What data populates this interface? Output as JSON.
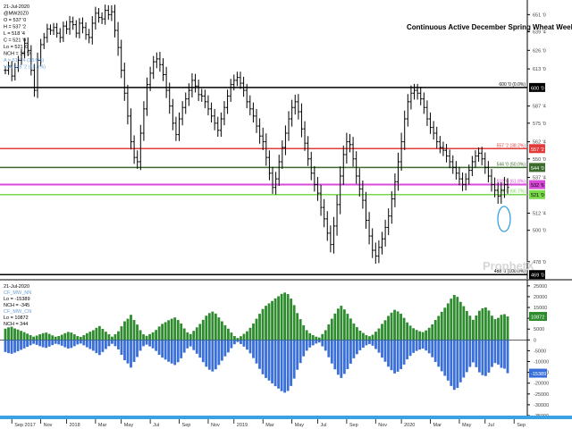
{
  "chart_data": [
    {
      "type": "ohlc",
      "title": "Continuous Active December Spring Wheat Weekly",
      "info_lines": [
        "21-Jul-2020",
        "@MW20Z0",
        "O = 537 '0",
        "H = 537 '2",
        "L = 518 '4",
        "C = 521 '0",
        "Lo = 521 '0",
        "NCH = 16 '0"
      ],
      "indicator_lines": [
        "A = 517 '4 (28.6%)",
        "VvA 518 '2 (18.1%)"
      ],
      "colors": {
        "info": "#000000",
        "indicator": "#6a9fd8",
        "bars": "#000000",
        "line_600": "#000000",
        "line_557": "#e23b3b",
        "line_544": "#3d6b2e",
        "line_532": "#d84bd8",
        "line_525": "#7ad84b",
        "line_469": "#000000",
        "circle": "#3aa2e0"
      },
      "ylim": [
        466,
        660
      ],
      "y_ticks": [
        {
          "v": 651,
          "label": "651 '0"
        },
        {
          "v": 639,
          "label": "639 '4"
        },
        {
          "v": 626,
          "label": "626 '0"
        },
        {
          "v": 613,
          "label": "613 '0"
        },
        {
          "v": 587,
          "label": "587 '4"
        },
        {
          "v": 575,
          "label": "575 '0"
        },
        {
          "v": 562,
          "label": "562 '4"
        },
        {
          "v": 550,
          "label": "550 '0"
        },
        {
          "v": 537,
          "label": "537 '4"
        },
        {
          "v": 512,
          "label": "512 '4"
        },
        {
          "v": 500,
          "label": "500 '0"
        },
        {
          "v": 478,
          "label": "478 '0"
        }
      ],
      "levels": [
        {
          "id": "line_600",
          "value": 600,
          "label": "600 '0 (0.0%)",
          "box": "600 '0"
        },
        {
          "id": "line_557",
          "value": 557.2,
          "label": "557 '2 (38.2%)",
          "box": "557 '2"
        },
        {
          "id": "line_544",
          "value": 544,
          "label": "544 '0 (50.0%)",
          "box": "544 '0"
        },
        {
          "id": "line_532",
          "value": 532,
          "label": "532 '6 (61.8%)",
          "box": "532 '6"
        },
        {
          "id": "line_525",
          "value": 525,
          "label": "525 '0 (66.7%)",
          "box": "521 '0"
        },
        {
          "id": "line_469",
          "value": 469,
          "label": "488 '0 (100.0%)",
          "box": "469 '0"
        }
      ],
      "x_labels": [
        "Sep 2017",
        "Nov",
        "2018",
        "Mar",
        "May",
        "Jul",
        "Sep",
        "Nov",
        "2019",
        "Mar",
        "May",
        "Jul",
        "Sep",
        "Nov",
        "2020",
        "Mar",
        "May",
        "Jul",
        "Sep"
      ],
      "weeks": 157,
      "week_index_of_labels": [
        2,
        11,
        19,
        28,
        36,
        45,
        54,
        63,
        71,
        80,
        89,
        97,
        106,
        115,
        123,
        132,
        141,
        149,
        158
      ],
      "closes": [
        612,
        615,
        608,
        614,
        619,
        624,
        631,
        626,
        612,
        598,
        619,
        630,
        635,
        641,
        640,
        642,
        638,
        635,
        643,
        641,
        646,
        644,
        638,
        645,
        642,
        637,
        635,
        645,
        652,
        649,
        648,
        654,
        651,
        653,
        640,
        628,
        612,
        596,
        580,
        562,
        551,
        548,
        568,
        585,
        602,
        610,
        618,
        620,
        616,
        609,
        598,
        587,
        575,
        567,
        578,
        586,
        592,
        598,
        605,
        601,
        595,
        594,
        590,
        585,
        580,
        575,
        570,
        578,
        586,
        594,
        602,
        605,
        607,
        603,
        598,
        590,
        585,
        580,
        573,
        566,
        562,
        551,
        540,
        530,
        536,
        548,
        558,
        568,
        578,
        586,
        590,
        583,
        571,
        561,
        550,
        540,
        532,
        526,
        516,
        508,
        498,
        490,
        503,
        518,
        538,
        553,
        562,
        560,
        550,
        538,
        529,
        521,
        507,
        496,
        486,
        482,
        488,
        494,
        502,
        510,
        522,
        534,
        548,
        562,
        578,
        590,
        596,
        598,
        596,
        592,
        586,
        578,
        572,
        568,
        562,
        558,
        556,
        552,
        548,
        544,
        540,
        536,
        532,
        536,
        542,
        548,
        552,
        554,
        550,
        544,
        538,
        532,
        528,
        524,
        528,
        532,
        530
      ],
      "spans": [
        6,
        7,
        8,
        7,
        7,
        7,
        8,
        9,
        8,
        10,
        12,
        9,
        7,
        8,
        7,
        7,
        7,
        8,
        7,
        8,
        9,
        8,
        7,
        8,
        9,
        8,
        9,
        11,
        10,
        8,
        8,
        9,
        8,
        10,
        11,
        13,
        12,
        12,
        13,
        12,
        10,
        11,
        13,
        12,
        11,
        10,
        9,
        10,
        11,
        10,
        12,
        12,
        11,
        10,
        10,
        10,
        10,
        11,
        11,
        10,
        10,
        9,
        10,
        10,
        10,
        11,
        10,
        10,
        10,
        10,
        9,
        9,
        9,
        9,
        10,
        10,
        10,
        10,
        11,
        12,
        13,
        13,
        11,
        10,
        11,
        11,
        11,
        12,
        12,
        12,
        11,
        12,
        13,
        12,
        11,
        11,
        11,
        12,
        13,
        13,
        12,
        12,
        14,
        15,
        15,
        14,
        14,
        12,
        12,
        12,
        12,
        13,
        13,
        13,
        12,
        12,
        11,
        11,
        12,
        12,
        12,
        13,
        14,
        14,
        13,
        12,
        12,
        10,
        10,
        10,
        10,
        11,
        10,
        10,
        10,
        9,
        9,
        10,
        10,
        10,
        10,
        10,
        10,
        9,
        9,
        9,
        9,
        9,
        10,
        10,
        10,
        11,
        11,
        12,
        12,
        12,
        10
      ]
    },
    {
      "type": "bar",
      "info_lines": [
        "21-Jul-2020",
        "CF_MW_NN",
        "Lo = -15389",
        "NCH = -345",
        "CF_MW_CN",
        "Lo = 10872",
        "NCH = 344"
      ],
      "colors": {
        "managed": "#2e8b2e",
        "commercial": "#3a6fd8",
        "zero": "#000000",
        "info": "#000000",
        "info2": "#6a9fd8"
      },
      "ylim": [
        -35000,
        27000
      ],
      "y_ticks": [
        {
          "v": 25000,
          "label": "25000"
        },
        {
          "v": 20000,
          "label": "20000"
        },
        {
          "v": 15000,
          "label": "15000"
        },
        {
          "v": 10000,
          "label": "10000"
        },
        {
          "v": 5000,
          "label": "5000"
        },
        {
          "v": 0,
          "label": "0"
        },
        {
          "v": -5000,
          "label": "-5000"
        },
        {
          "v": -10000,
          "label": "-10000"
        },
        {
          "v": -15000,
          "label": "-15000"
        },
        {
          "v": -20000,
          "label": "-20000"
        },
        {
          "v": -25000,
          "label": "-25000"
        },
        {
          "v": -30000,
          "label": "-30000"
        },
        {
          "v": -35000,
          "label": "-35000"
        }
      ],
      "boxes": [
        {
          "value": 10872,
          "label": "10872",
          "color": "#2e8b2e"
        },
        {
          "value": -15389,
          "label": "-15389",
          "color": "#3a6fd8"
        }
      ],
      "series": [
        {
          "values": [
            5200,
            5800,
            6100,
            5300,
            4800,
            4200,
            3600,
            2900,
            2200,
            1500,
            2000,
            2600,
            3100,
            3400,
            2800,
            2100,
            1500,
            1800,
            2400,
            3100,
            3700,
            3400,
            2600,
            1800,
            1400,
            2200,
            3100,
            3800,
            4500,
            5600,
            6400,
            5100,
            3800,
            2600,
            1500,
            2600,
            4000,
            6300,
            8600,
            9800,
            11600,
            9200,
            7100,
            4500,
            2600,
            1900,
            2700,
            3500,
            4600,
            6200,
            7400,
            8200,
            9100,
            9800,
            10400,
            9200,
            7600,
            5300,
            3500,
            2700,
            4200,
            5800,
            7400,
            9300,
            11200,
            12400,
            13100,
            12200,
            10400,
            8600,
            6800,
            5200,
            3400,
            1800,
            900,
            1700,
            2800,
            4000,
            5600,
            7600,
            9800,
            12100,
            14300,
            15800,
            16900,
            18000,
            19200,
            20200,
            21300,
            21900,
            21200,
            19100,
            16100,
            12400,
            9600,
            6800,
            4500,
            3100,
            2200,
            1500,
            1100,
            2700,
            4500,
            7200,
            9800,
            12200,
            14500,
            15800,
            14100,
            12100,
            9900,
            7600,
            5900,
            4300,
            3200,
            2200,
            1700,
            2400,
            3800,
            5300,
            7400,
            9100,
            11100,
            12600,
            13900,
            13200,
            12100,
            10200,
            8100,
            6600,
            5400,
            4600,
            4000,
            3600,
            4400,
            5600,
            7200,
            9200,
            11100,
            13000,
            14900,
            16900,
            19100,
            20800,
            19900,
            17600,
            15600,
            13400,
            11200,
            9300,
            11300,
            13500,
            14600,
            15000,
            13600,
            11200,
            9600,
            10200,
            11600,
            11900,
            10872
          ]
        },
        {
          "values": [
            -5600,
            -6100,
            -6400,
            -5900,
            -5200,
            -4600,
            -3900,
            -3200,
            -2500,
            -1800,
            -2300,
            -2900,
            -3400,
            -3700,
            -3100,
            -2400,
            -1800,
            -2100,
            -2700,
            -3400,
            -4000,
            -3700,
            -2900,
            -2100,
            -1700,
            -2500,
            -3400,
            -4200,
            -5000,
            -6100,
            -7000,
            -5600,
            -4200,
            -2900,
            -1800,
            -2900,
            -4400,
            -6900,
            -9400,
            -10900,
            -12800,
            -10200,
            -7900,
            -5000,
            -2900,
            -2200,
            -3000,
            -3900,
            -5100,
            -6900,
            -8200,
            -9100,
            -10100,
            -10900,
            -11600,
            -10300,
            -8500,
            -5900,
            -3900,
            -3000,
            -4700,
            -6400,
            -8200,
            -10300,
            -12400,
            -13800,
            -14600,
            -13600,
            -11600,
            -9600,
            -7600,
            -5800,
            -3800,
            -2000,
            -1000,
            -1900,
            -3100,
            -4500,
            -6200,
            -8400,
            -10900,
            -13400,
            -15900,
            -17600,
            -18800,
            -20100,
            -21400,
            -22500,
            -23700,
            -24400,
            -23600,
            -21300,
            -17900,
            -13800,
            -10700,
            -7600,
            -5000,
            -3500,
            -2500,
            -1700,
            -1200,
            -3000,
            -5000,
            -8000,
            -10900,
            -13600,
            -16100,
            -17600,
            -15700,
            -13500,
            -11000,
            -8500,
            -6600,
            -4800,
            -3600,
            -2500,
            -1900,
            -2700,
            -4200,
            -5900,
            -8200,
            -10100,
            -12400,
            -14000,
            -15500,
            -14700,
            -13500,
            -11400,
            -9000,
            -7400,
            -6000,
            -5100,
            -4500,
            -4000,
            -4900,
            -6200,
            -8000,
            -10200,
            -12400,
            -14500,
            -16600,
            -18800,
            -21300,
            -23100,
            -22200,
            -19600,
            -17400,
            -14900,
            -12500,
            -10400,
            -12600,
            -15000,
            -16300,
            -16700,
            -15100,
            -12500,
            -10700,
            -11400,
            -12900,
            -13300,
            -15389
          ]
        }
      ],
      "x_labels": [
        "Sep 2017",
        "Nov",
        "2018",
        "Mar",
        "May",
        "Jul",
        "Sep",
        "Nov",
        "2019",
        "Mar",
        "May",
        "Jul",
        "Sep",
        "Nov",
        "2020",
        "Mar",
        "May",
        "Jul",
        "Sep"
      ]
    }
  ],
  "watermark": "ProphetX"
}
